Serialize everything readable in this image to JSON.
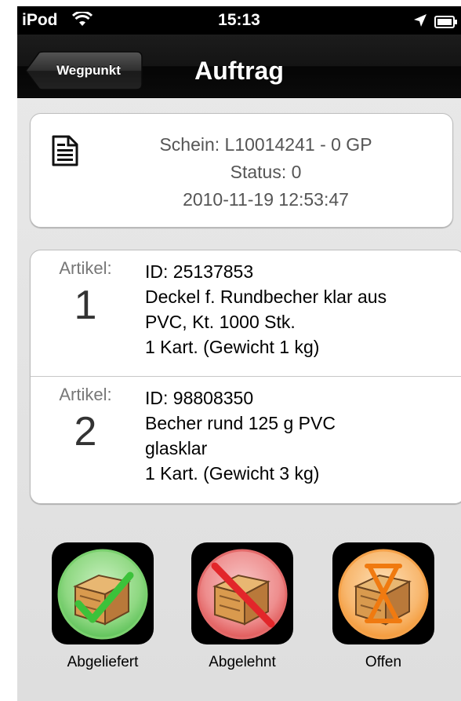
{
  "status_bar": {
    "carrier": "iPod",
    "time": "15:13"
  },
  "nav": {
    "back_label": "Wegpunkt",
    "title": "Auftrag"
  },
  "header": {
    "schein": "Schein: L10014241 - 0 GP",
    "status": "Status: 0",
    "date": "2010-11-19 12:53:47"
  },
  "items": [
    {
      "label": "Artikel:",
      "number": "1",
      "lines": [
        "ID: 25137853",
        "Deckel f. Rundbecher klar aus",
        "PVC, Kt. 1000 Stk.",
        "1 Kart. (Gewicht 1 kg)"
      ]
    },
    {
      "label": "Artikel:",
      "number": "2",
      "lines": [
        "ID: 98808350",
        "Becher rund 125 g PVC",
        "glasklar",
        "1 Kart. (Gewicht 3 kg)"
      ]
    }
  ],
  "actions": [
    {
      "label": "Abgeliefert",
      "icon": "box-checkmark-icon",
      "color": "#5fc25a"
    },
    {
      "label": "Abgelehnt",
      "icon": "box-rejected-icon",
      "color": "#e05a5a"
    },
    {
      "label": "Offen",
      "icon": "box-hourglass-icon",
      "color": "#f39a3a"
    }
  ]
}
